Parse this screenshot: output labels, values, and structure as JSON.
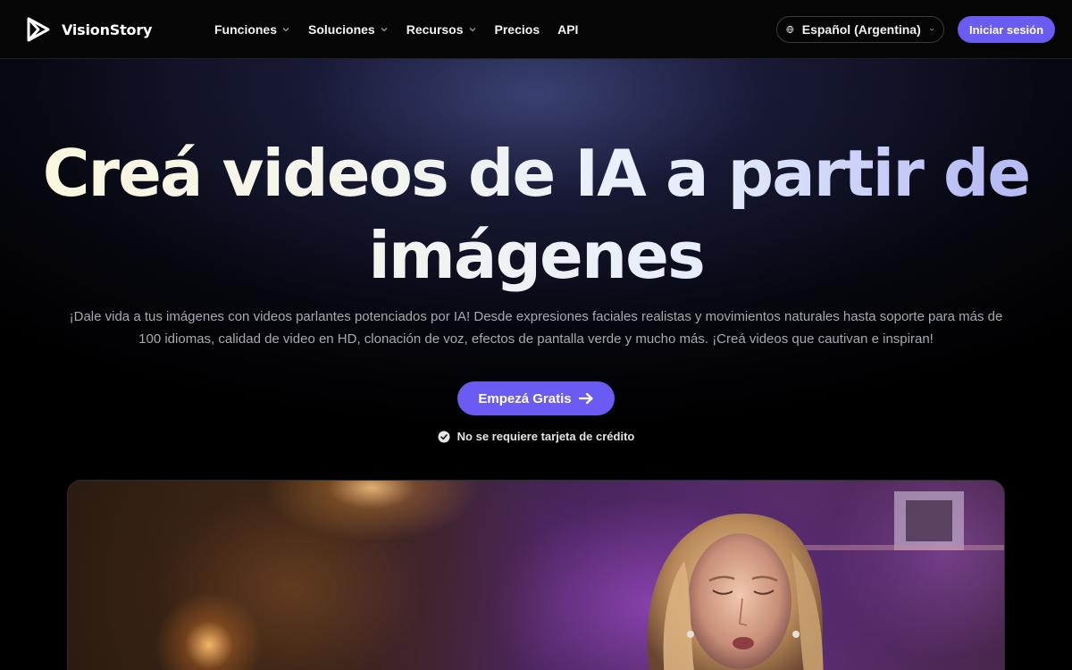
{
  "brand": {
    "name": "VisionStory",
    "logo_icon": "play-triangle-icon"
  },
  "nav": {
    "items": [
      {
        "label": "Funciones",
        "has_dropdown": true
      },
      {
        "label": "Soluciones",
        "has_dropdown": true
      },
      {
        "label": "Recursos",
        "has_dropdown": true
      },
      {
        "label": "Precios",
        "has_dropdown": false
      },
      {
        "label": "API",
        "has_dropdown": false
      }
    ],
    "language": {
      "label": "Español (Argentina)",
      "icon": "globe-icon"
    },
    "login_label": "Iniciar sesión"
  },
  "hero": {
    "title": "Creá videos de IA a partir de imágenes",
    "subtitle": "¡Dale vida a tus imágenes con videos parlantes potenciados por IA! Desde expresiones faciales realistas y movimientos naturales hasta soporte para más de 100 idiomas, calidad de video en HD, clonación de voz, efectos de pantalla verde y mucho más. ¡Creá videos que cautivan e inspiran!",
    "cta_label": "Empezá Gratis",
    "cta_icon": "arrow-right-icon",
    "note": "No se requiere tarjeta de crédito",
    "note_icon": "check-circle-icon"
  },
  "colors": {
    "accent": "#6a5cf2",
    "background": "#000000",
    "subtitle_text": "#a7a9b2"
  }
}
